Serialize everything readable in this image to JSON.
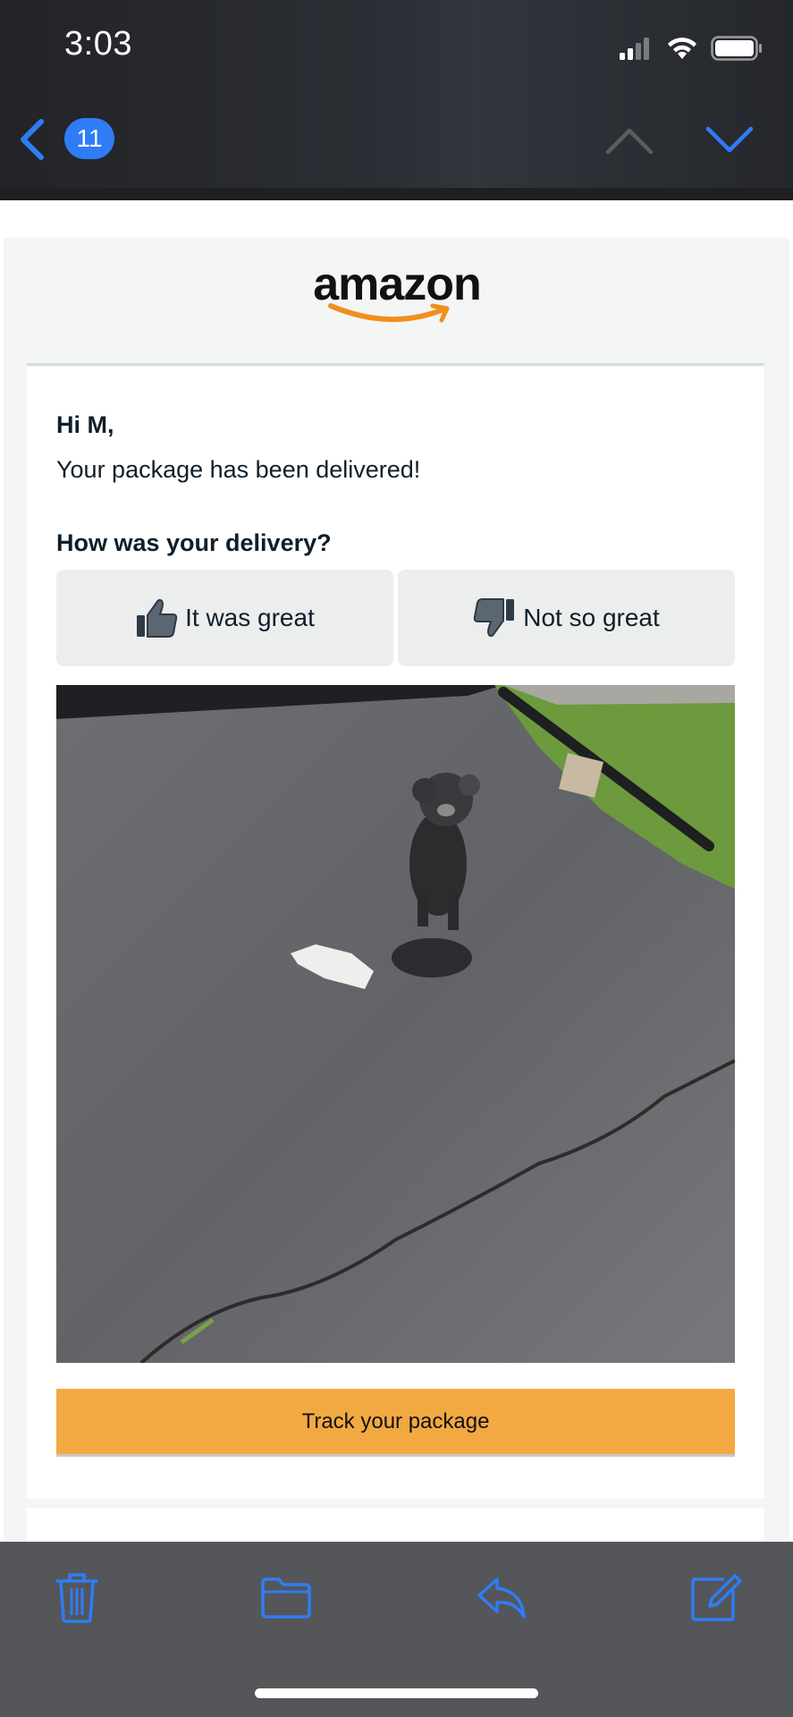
{
  "status_bar": {
    "time": "3:03"
  },
  "nav": {
    "message_count": "11"
  },
  "email": {
    "brand": "amazon",
    "greeting": "Hi M,",
    "message": "Your package has been delivered!",
    "question": "How was your delivery?",
    "feedback_positive": "It was great",
    "feedback_negative": "Not so great",
    "track_button": "Track your package"
  },
  "colors": {
    "accent_blue": "#2f7cf6",
    "track_orange": "#f2a942",
    "amazon_smile": "#f08f1c"
  },
  "icons": [
    "back-chevron-icon",
    "chevron-up-icon",
    "chevron-down-icon",
    "thumbs-up-icon",
    "thumbs-down-icon",
    "trash-icon",
    "folder-icon",
    "reply-icon",
    "compose-icon",
    "signal-icon",
    "wifi-icon",
    "battery-icon"
  ]
}
